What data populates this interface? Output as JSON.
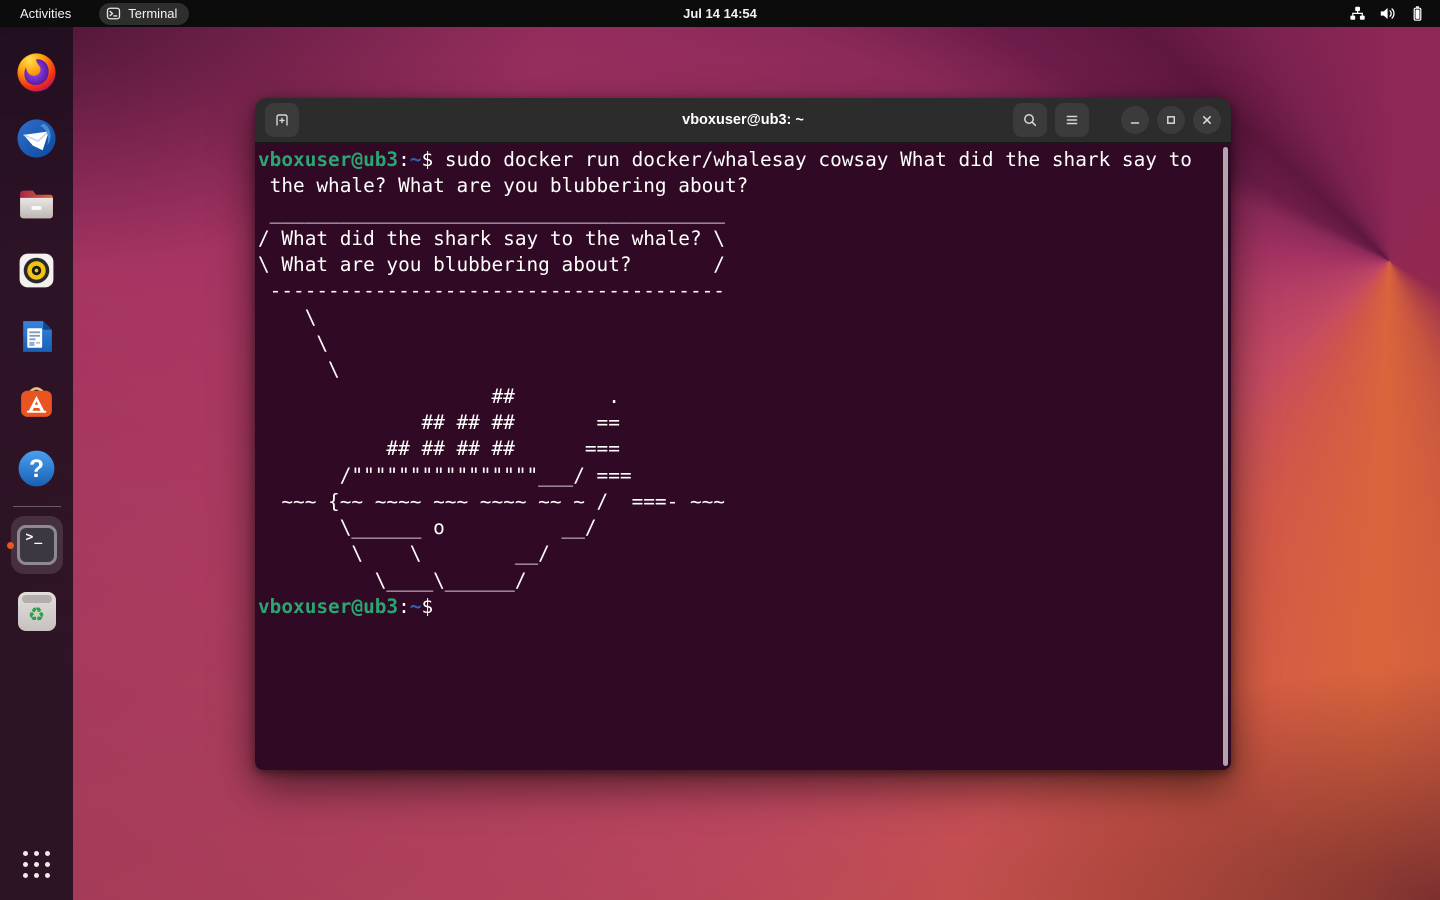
{
  "top_bar": {
    "activities_label": "Activities",
    "focused_app": "Terminal",
    "clock": "Jul 14  14:54",
    "status_icons": [
      "network-icon",
      "volume-icon",
      "battery-icon"
    ]
  },
  "dock": {
    "items": [
      {
        "icon": "firefox-icon"
      },
      {
        "icon": "thunderbird-icon"
      },
      {
        "icon": "files-icon"
      },
      {
        "icon": "rhythmbox-icon"
      },
      {
        "icon": "libreoffice-writer-icon"
      },
      {
        "icon": "ubuntu-software-icon"
      },
      {
        "icon": "help-icon"
      },
      {
        "icon": "terminal-icon",
        "running": true
      },
      {
        "icon": "trash-icon"
      }
    ],
    "terminal_glyph": ">_",
    "trash_glyph": "♻",
    "help_glyph": "?",
    "show_apps_icon": "show-apps-grid-icon"
  },
  "window": {
    "title": "vboxuser@ub3: ~",
    "header_icons": [
      "new-tab-icon",
      "search-icon",
      "menu-icon",
      "minimize-icon",
      "maximize-icon",
      "close-icon"
    ]
  },
  "terminal": {
    "prompt_user": "vboxuser@ub3",
    "prompt_colon": ":",
    "prompt_path": "~",
    "prompt_dollar": "$",
    "command": " sudo docker run docker/whalesay cowsay What did the shark say to\n the whale? What are you blubbering about?\n",
    "cowsay_output": " _______________________________________ \n/ What did the shark say to the whale? \\\n\\ What are you blubbering about?       /\n ---------------------------------------\n    \\\n     \\\n      \\\n                    ##        .\n              ## ## ##       ==\n           ## ## ## ##      ===\n       /\"\"\"\"\"\"\"\"\"\"\"\"\"\"\"\"___/ ===\n  ~~~ {~~ ~~~~ ~~~ ~~~~ ~~ ~ /  ===- ~~~\n       \\______ o          __/\n        \\    \\        __/\n          \\____\\______/\n",
    "colors": {
      "background": "#300A24",
      "foreground": "#FFFFFF",
      "prompt_green": "#2BA573",
      "path_blue": "#2E62B5"
    }
  },
  "colors": {
    "accent_orange": "#E95420",
    "topbar_bg": "#0C0C0C",
    "headerbar_bg": "#2C2C2C"
  }
}
